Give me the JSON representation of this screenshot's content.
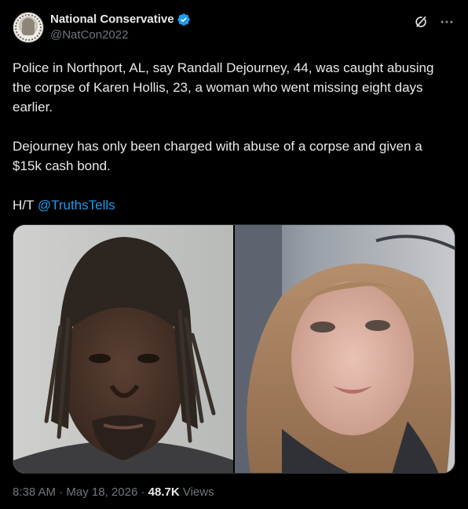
{
  "author": {
    "display_name": "National Conservative",
    "handle": "@NatCon2022",
    "verified_color": "#1d9bf0"
  },
  "post": {
    "paragraph_1": "Police in Northport, AL, say Randall Dejourney, 44, was caught abusing the corpse of Karen Hollis, 23, a woman who went missing eight days earlier.",
    "paragraph_2": "Dejourney has only been charged with abuse of a corpse and given a $15k cash bond.",
    "ht_prefix": "H/T",
    "ht_mention": "@TruthsTells"
  },
  "meta": {
    "time": "8:38 AM",
    "separator_1": "·",
    "date": "May 18, 2026",
    "separator_2": "·",
    "views_count": "48.7K",
    "views_label": "Views"
  },
  "icons": {
    "grok": "grok-icon",
    "more": "more-icon",
    "verified": "verified-badge-icon"
  },
  "colors": {
    "background": "#000000",
    "text": "#e7e9ea",
    "secondary": "#71767b",
    "link": "#1d9bf0"
  }
}
